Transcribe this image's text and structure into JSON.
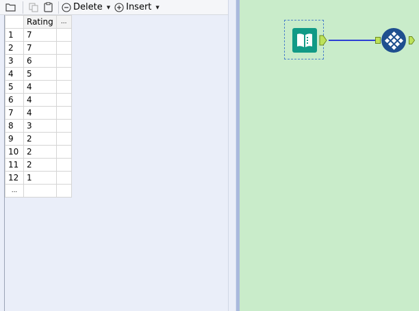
{
  "toolbar": {
    "delete_label": "Delete",
    "insert_label": "Insert",
    "icons": [
      "folder-icon",
      "copy-icon",
      "paste-icon",
      "minus-circle-icon",
      "plus-circle-icon"
    ]
  },
  "grid": {
    "header": [
      "Rating",
      "..."
    ],
    "rows": [
      {
        "num": "1",
        "rating": "7"
      },
      {
        "num": "2",
        "rating": "7"
      },
      {
        "num": "3",
        "rating": "6"
      },
      {
        "num": "4",
        "rating": "5"
      },
      {
        "num": "5",
        "rating": "4"
      },
      {
        "num": "6",
        "rating": "4"
      },
      {
        "num": "7",
        "rating": "4"
      },
      {
        "num": "8",
        "rating": "3"
      },
      {
        "num": "9",
        "rating": "2"
      },
      {
        "num": "10",
        "rating": "2"
      },
      {
        "num": "11",
        "rating": "2"
      },
      {
        "num": "12",
        "rating": "1"
      }
    ],
    "new_row_marker": "..."
  },
  "canvas": {
    "background": "#c9ecca",
    "connection_color": "#2c3fd4",
    "tools": [
      {
        "name": "text-input-tool",
        "icon": "book-icon",
        "color": "#119a86"
      },
      {
        "name": "browse-tool",
        "icon": "diamond-grid-icon",
        "color": "#1f4f8f"
      }
    ]
  }
}
